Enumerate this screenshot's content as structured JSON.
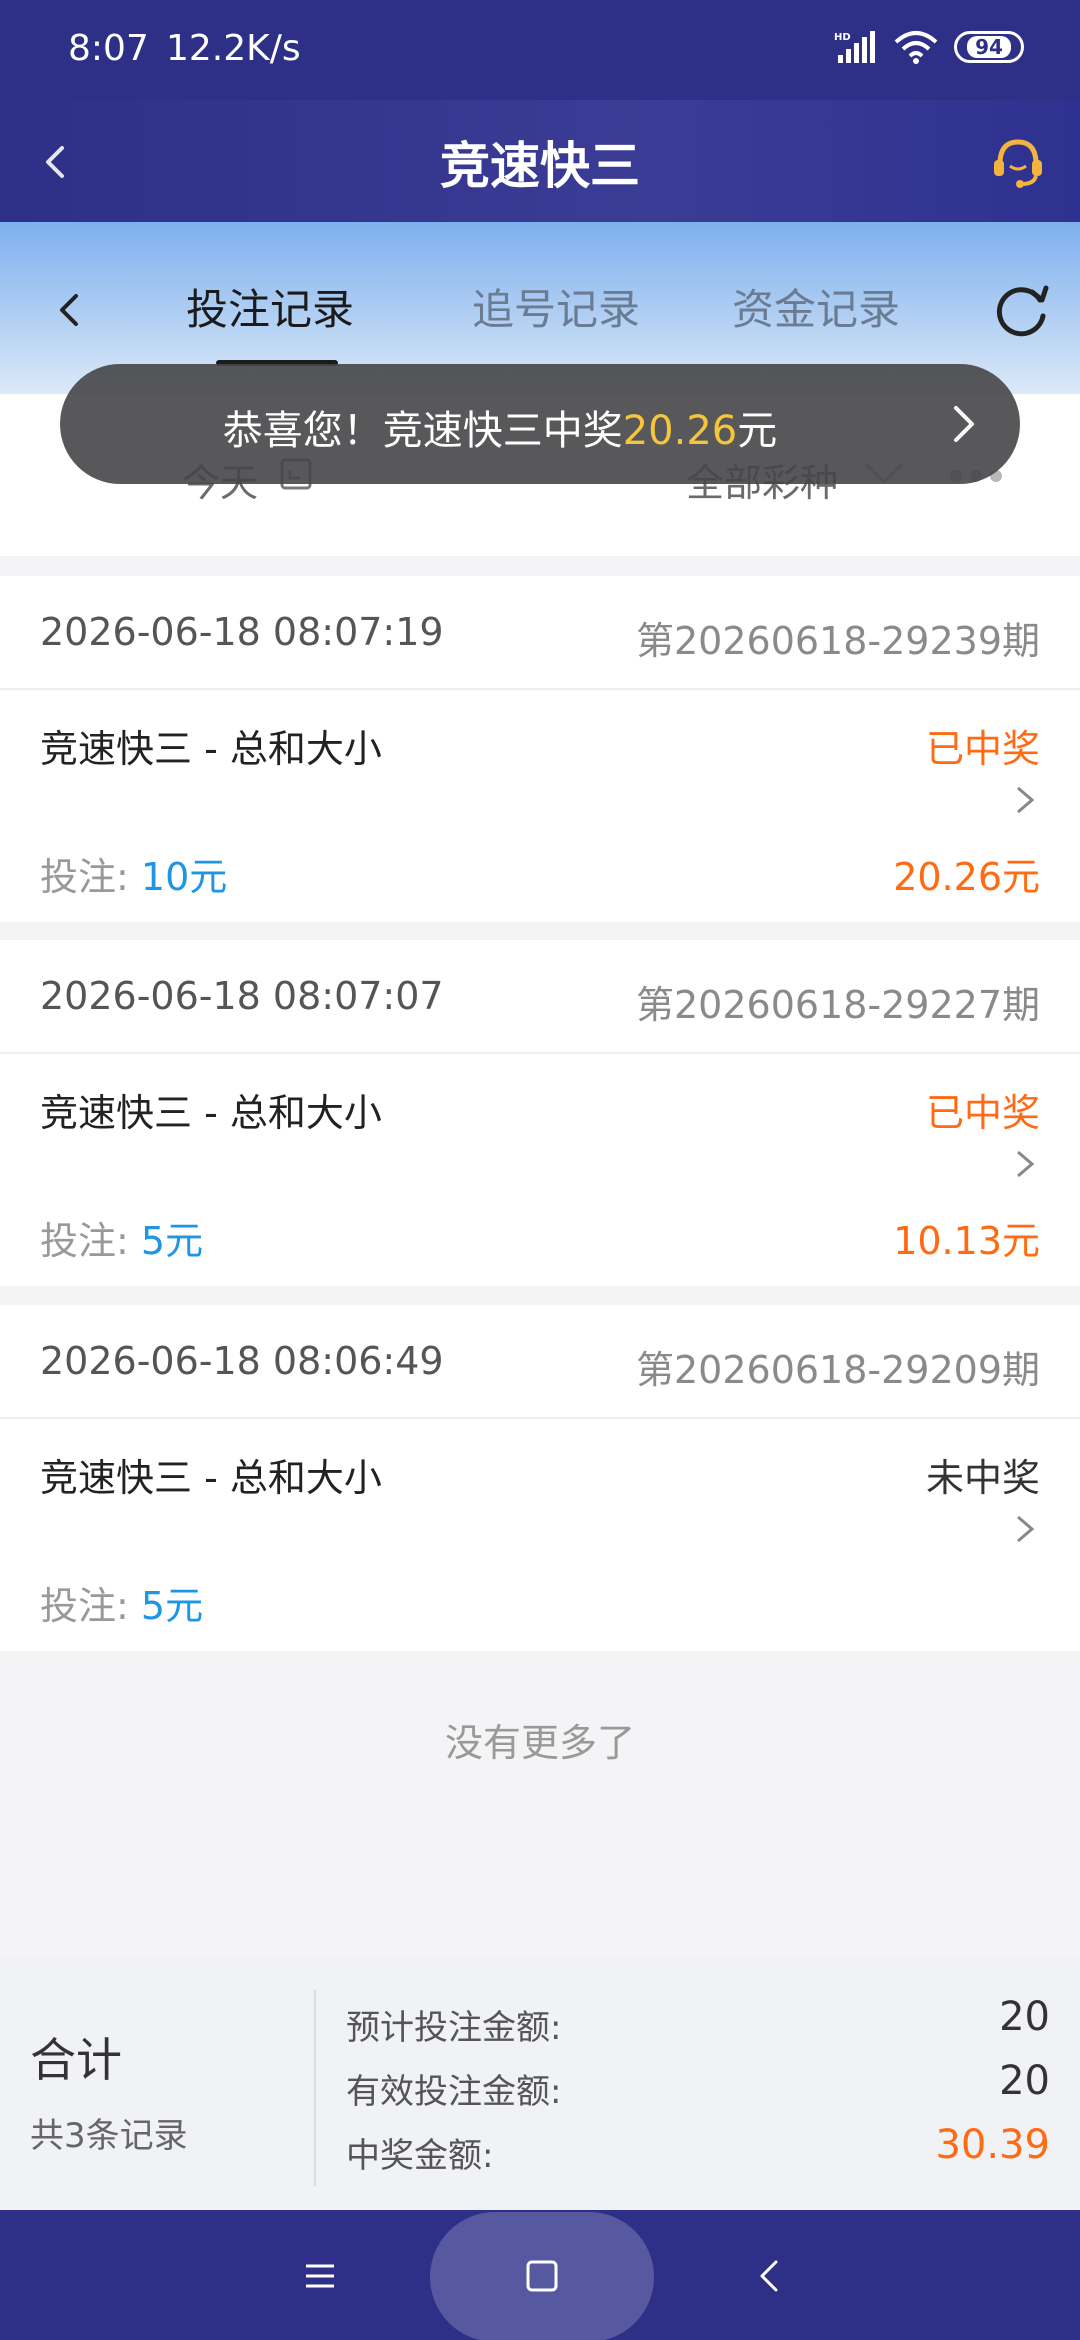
{
  "status_bar": {
    "time": "8:07",
    "speed": "12.2K/s",
    "battery": "94"
  },
  "header": {
    "title": "竞速快三"
  },
  "tabs": [
    {
      "label": "投注记录",
      "active": true
    },
    {
      "label": "追号记录",
      "active": false
    },
    {
      "label": "资金记录",
      "active": false
    }
  ],
  "filter": {
    "date": "今天",
    "lottery_type": "全部彩种"
  },
  "toast": {
    "prefix": "恭喜您！竞速快三中奖",
    "amount": "20.26",
    "suffix": "元"
  },
  "records": [
    {
      "time": "2026-06-18 08:07:19",
      "issue": "第20260618-29239期",
      "game": "竞速快三 - 总和大小",
      "status": "已中奖",
      "bet_label": "投注: ",
      "bet": "10元",
      "win": "20.26元"
    },
    {
      "time": "2026-06-18 08:07:07",
      "issue": "第20260618-29227期",
      "game": "竞速快三 - 总和大小",
      "status": "已中奖",
      "bet_label": "投注: ",
      "bet": "5元",
      "win": "10.13元"
    },
    {
      "time": "2026-06-18 08:06:49",
      "issue": "第20260618-29209期",
      "game": "竞速快三 - 总和大小",
      "status": "未中奖",
      "bet_label": "投注: ",
      "bet": "5元",
      "win": ""
    }
  ],
  "no_more": "没有更多了",
  "summary": {
    "title": "合计",
    "count": "共3条记录",
    "rows": [
      {
        "label": "预计投注金额:",
        "value": "20"
      },
      {
        "label": "有效投注金额:",
        "value": "20"
      },
      {
        "label": "中奖金额:",
        "value": "30.39"
      }
    ]
  },
  "colors": {
    "primary": "#2e3087",
    "accent_orange": "#ff6a13",
    "accent_blue": "#1d96e6",
    "toast_amount": "#f5c63b"
  }
}
